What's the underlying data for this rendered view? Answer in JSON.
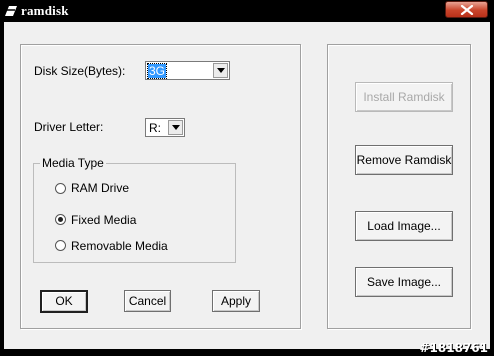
{
  "window": {
    "title": "ramdisk"
  },
  "settings": {
    "disk_size_label": "Disk Size(Bytes):",
    "disk_size_value": "3G",
    "driver_letter_label": "Driver Letter:",
    "driver_letter_value": "R:"
  },
  "media_type": {
    "legend": "Media Type",
    "options": [
      {
        "label": "RAM Drive",
        "selected": false
      },
      {
        "label": "Fixed Media",
        "selected": true
      },
      {
        "label": "Removable Media",
        "selected": false
      }
    ]
  },
  "footer_buttons": {
    "ok": "OK",
    "cancel": "Cancel",
    "apply": "Apply"
  },
  "side_buttons": {
    "install": "Install Ramdisk",
    "remove": "Remove Ramdisk",
    "load": "Load Image...",
    "save": "Save Image..."
  },
  "watermark": "#1818761",
  "colors": {
    "titlebar": "#000000",
    "close_button": "#c9442b",
    "selection": "#3399ff"
  }
}
